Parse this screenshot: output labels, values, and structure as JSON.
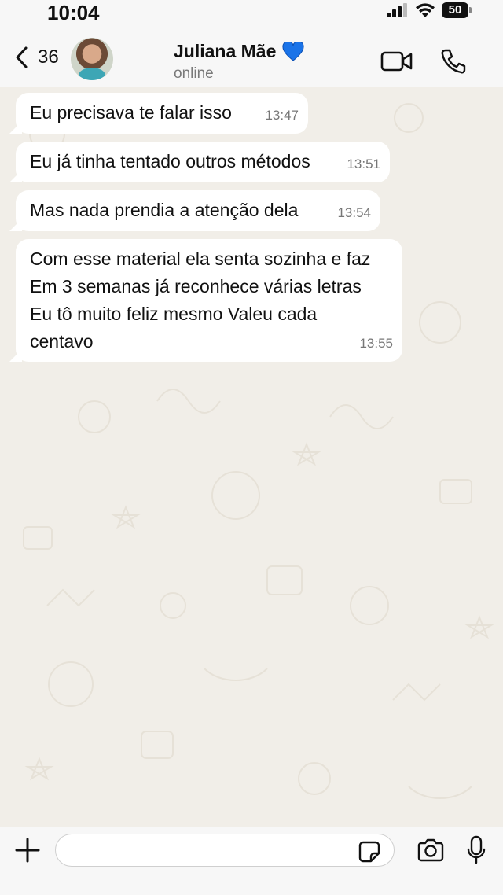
{
  "status_bar": {
    "time": "10:04",
    "battery": "50"
  },
  "header": {
    "back_count": "36",
    "contact_name": "Juliana Mãe",
    "contact_emoji": "💙",
    "contact_status": "online"
  },
  "messages": [
    {
      "text": "Eu precisava te falar isso",
      "time": "13:47"
    },
    {
      "text": "Eu já tinha tentado outros métodos",
      "time": "13:51"
    },
    {
      "text": "Mas nada prendia a atenção dela",
      "time": "13:54"
    },
    {
      "text": "Com esse material ela senta sozinha e faz\nEm 3 semanas já reconhece várias letras\nEu tô muito feliz mesmo Valeu cada\ncentavo",
      "time": "13:55"
    }
  ],
  "input": {
    "placeholder": ""
  },
  "colors": {
    "bubble": "#ffffff",
    "wallpaper": "#f1eee8",
    "bar": "#f7f7f7",
    "heart": "#1a73e8"
  },
  "icons": [
    "back-chevron-icon",
    "video-camera-icon",
    "phone-icon",
    "plus-icon",
    "sticker-icon",
    "camera-icon",
    "microphone-icon"
  ]
}
